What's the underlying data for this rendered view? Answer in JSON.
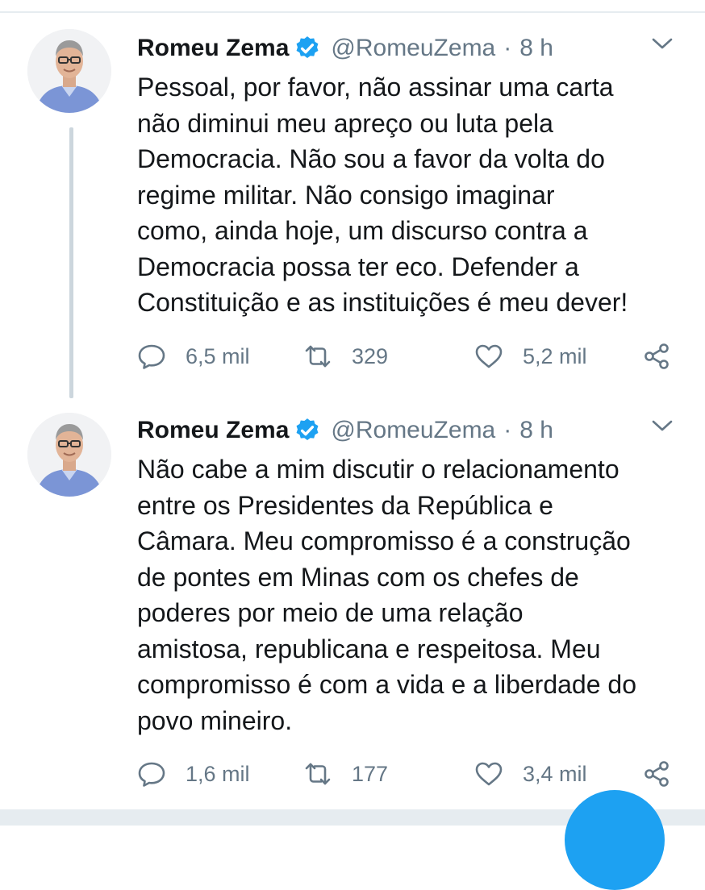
{
  "tweets": [
    {
      "author": "Romeu Zema",
      "handle": "@RomeuZema",
      "separator": "·",
      "time": "8 h",
      "verified": true,
      "text_lines": [
        "Pessoal, por favor, não assinar uma carta",
        "não diminui meu apreço ou luta pela",
        "Democracia. Não sou a favor da volta do",
        "regime militar. Não consigo imaginar",
        "como, ainda hoje, um discurso contra a",
        "Democracia possa ter eco. Defender a",
        "Constituição e as instituições é meu dever!"
      ],
      "replies": "6,5 mil",
      "retweets": "329",
      "likes": "5,2 mil"
    },
    {
      "author": "Romeu Zema",
      "handle": "@RomeuZema",
      "separator": "·",
      "time": "8 h",
      "verified": true,
      "text_lines": [
        "Não cabe a mim discutir o relacionamento",
        "entre os Presidentes da República e",
        "Câmara. Meu compromisso é a construção",
        "de pontes em Minas com os chefes de",
        "poderes por meio de uma relação",
        "amistosa, republicana e respeitosa. Meu",
        "compromisso é com a vida e a liberdade do",
        "povo mineiro."
      ],
      "replies": "1,6 mil",
      "retweets": "177",
      "likes": "3,4 mil"
    }
  ],
  "icons": {
    "verified": "verified-badge-icon",
    "caret": "chevron-down-icon",
    "reply": "reply-icon",
    "retweet": "retweet-icon",
    "like": "heart-icon",
    "share": "share-icon"
  },
  "colors": {
    "accent": "#1da1f2",
    "secondary_text": "#657786",
    "thread_line": "#ccd6dd",
    "divider": "#e6ecf0"
  }
}
